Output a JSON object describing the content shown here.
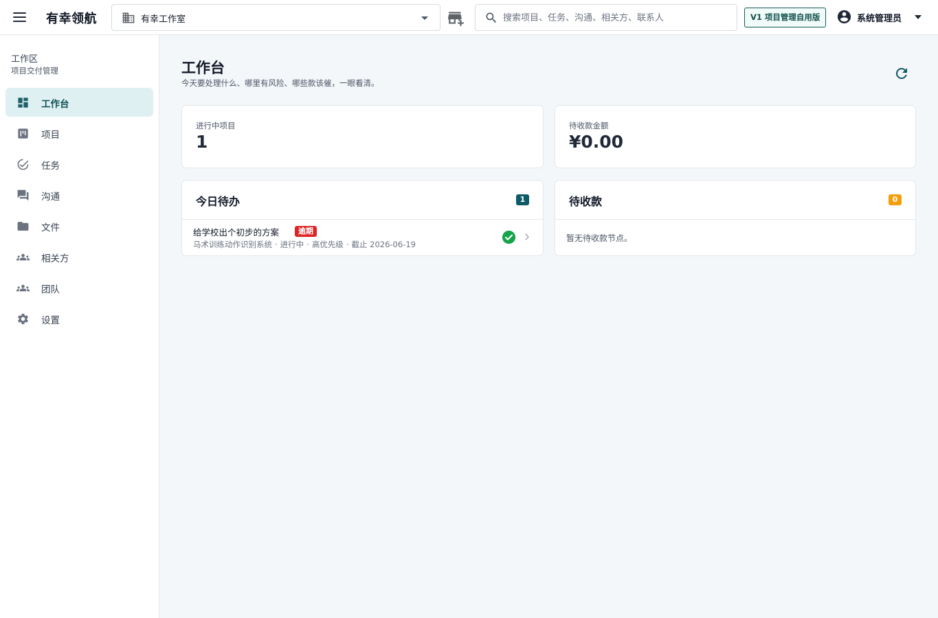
{
  "app": {
    "brand": "有幸领航"
  },
  "header": {
    "org_name": "有幸工作室",
    "search_placeholder": "搜索项目、任务、沟通、相关方、联系人",
    "version_badge": "V1 项目管理自用版",
    "user_name": "系统管理员",
    "icons": [
      "menu-icon",
      "building-icon",
      "add-store-icon",
      "search-icon",
      "account-circle-icon",
      "caret-down-icon"
    ]
  },
  "sidebar": {
    "title": "工作区",
    "subtitle": "项目交付管理",
    "items": [
      {
        "label": "工作台",
        "icon": "dashboard-icon",
        "active": true
      },
      {
        "label": "项目",
        "icon": "kanban-icon",
        "active": false
      },
      {
        "label": "任务",
        "icon": "check-circle-icon",
        "active": false
      },
      {
        "label": "沟通",
        "icon": "chat-icon",
        "active": false
      },
      {
        "label": "文件",
        "icon": "folder-icon",
        "active": false
      },
      {
        "label": "相关方",
        "icon": "groups-icon",
        "active": false
      },
      {
        "label": "团队",
        "icon": "team-icon",
        "active": false
      },
      {
        "label": "设置",
        "icon": "gear-icon",
        "active": false
      }
    ]
  },
  "main": {
    "title": "工作台",
    "subtitle": "今天要处理什么、哪里有风险、哪些款该催，一眼看清。",
    "stats": [
      {
        "label": "进行中项目",
        "value": "1"
      },
      {
        "label": "待收款金额",
        "value": "¥0.00"
      }
    ],
    "todo": {
      "title": "今日待办",
      "count": "1",
      "tasks": [
        {
          "title": "给学校出个初步的方案",
          "tag": "逾期",
          "project": "马术训练动作识别系统",
          "status": "进行中",
          "priority": "高优先级",
          "deadline": "截止 2026-06-19"
        }
      ]
    },
    "receivables": {
      "title": "待收款",
      "count": "0",
      "empty": "暂无待收款节点。"
    }
  },
  "colors": {
    "accent": "#0e5a66",
    "active_bg": "#dff0f2",
    "overdue": "#dc2626",
    "done": "#16a34a",
    "warning": "#f59e0b"
  }
}
